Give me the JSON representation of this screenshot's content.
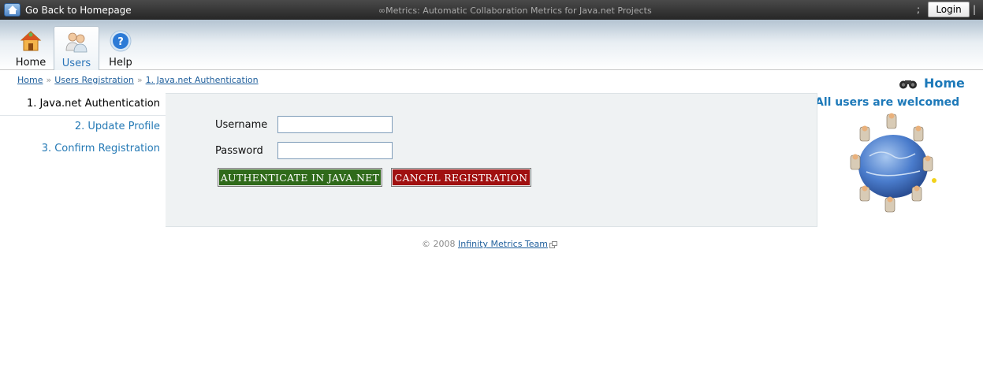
{
  "topbar": {
    "back_label": "Go Back to Homepage",
    "app_title": "∞Metrics: Automatic Collaboration Metrics for Java.net Projects",
    "semicolon": ";",
    "login_label": "Login",
    "separator": "|"
  },
  "tabs": [
    {
      "label": "Home",
      "icon": "house-icon",
      "active": false
    },
    {
      "label": "Users",
      "icon": "users-icon",
      "active": true
    },
    {
      "label": "Help",
      "icon": "help-icon",
      "active": false
    }
  ],
  "breadcrumb": {
    "items": [
      "Home",
      "Users Registration",
      "1. Java.net Authentication"
    ],
    "separator": "»"
  },
  "steps": [
    {
      "label": "1. Java.net Authentication",
      "active": true
    },
    {
      "label": "2. Update Profile",
      "active": false
    },
    {
      "label": "3. Confirm Registration",
      "active": false
    }
  ],
  "form": {
    "username_label": "Username",
    "username_value": "",
    "password_label": "Password",
    "password_value": "",
    "authenticate_label": "AUTHENTICATE IN JAVA.NET",
    "cancel_label": "CANCEL REGISTRATION"
  },
  "right_panel": {
    "home_label": "Home",
    "home_icon": "binoculars-icon",
    "welcome_text": "All users are welcomed",
    "image": "people-around-globe-illustration"
  },
  "footer": {
    "copyright": "© 2008",
    "link_label": "Infinity Metrics Team",
    "link_icon": "external-link-icon"
  },
  "colors": {
    "accent": "#1d79b9",
    "link": "#1f5f9c",
    "auth_button": "#2f6a1a",
    "cancel_button": "#a01010",
    "panel_bg": "#eff2f3"
  }
}
